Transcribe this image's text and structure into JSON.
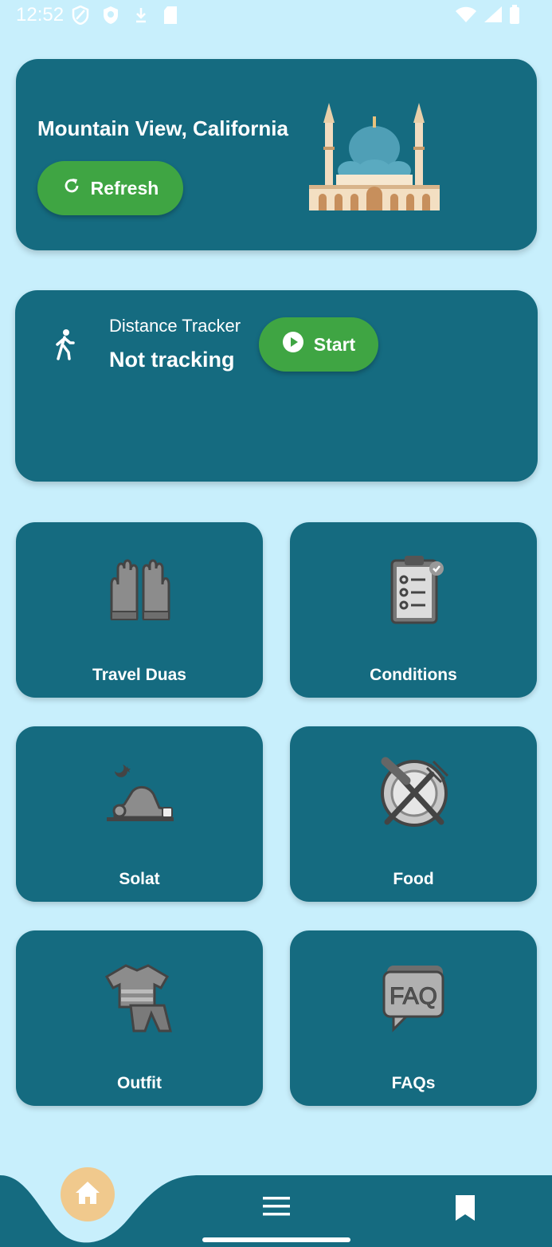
{
  "status_bar": {
    "time": "12:52"
  },
  "location": {
    "title": "Mountain View, California",
    "refresh_label": "Refresh"
  },
  "tracker": {
    "label": "Distance Tracker",
    "status": "Not tracking",
    "start_label": "Start"
  },
  "tiles": [
    {
      "label": "Travel Duas",
      "icon": "praying-hands-icon"
    },
    {
      "label": "Conditions",
      "icon": "clipboard-checklist-icon"
    },
    {
      "label": "Solat",
      "icon": "prostrating-person-icon"
    },
    {
      "label": "Food",
      "icon": "plate-fork-knife-icon"
    },
    {
      "label": "Outfit",
      "icon": "clothing-icon"
    },
    {
      "label": "FAQs",
      "icon": "faq-speech-bubble-icon"
    }
  ],
  "bottom_nav": {
    "items": [
      "home-icon",
      "menu-icon",
      "bookmark-icon"
    ]
  },
  "colors": {
    "background": "#c8effc",
    "card": "#156b80",
    "button_green": "#3fa543",
    "home_accent": "#f0c98d"
  }
}
